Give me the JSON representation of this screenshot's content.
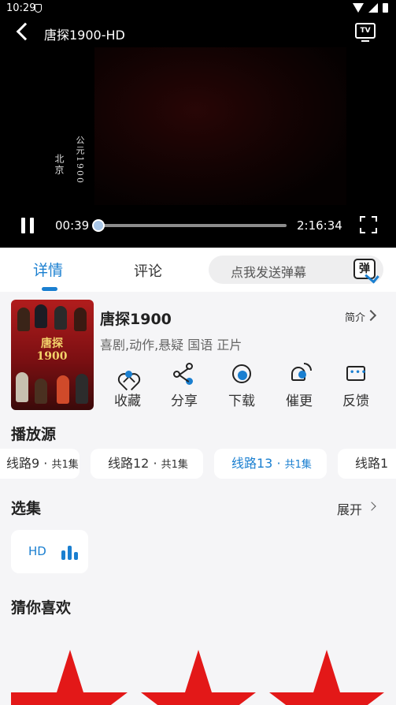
{
  "status_bar": {
    "time": "10:29"
  },
  "player": {
    "title": "唐探1900-HD",
    "overlay_text": [
      "公元1900",
      "北京"
    ],
    "current_time": "00:39",
    "total_time": "2:16:34",
    "progress": 0.005,
    "tv_icon_label": "TV"
  },
  "tabs": {
    "details": "详情",
    "comments": "评论"
  },
  "danmaku": {
    "placeholder": "点我发送弹幕",
    "icon_text": "弹"
  },
  "movie": {
    "title": "唐探1900",
    "tags": "喜剧,动作,悬疑 国语 正片",
    "intro_label": "简介",
    "poster_title": "唐探1900"
  },
  "actions": [
    {
      "label": "收藏",
      "icon": "favorite-icon"
    },
    {
      "label": "分享",
      "icon": "share-icon"
    },
    {
      "label": "下载",
      "icon": "download-icon"
    },
    {
      "label": "催更",
      "icon": "urge-update-icon"
    },
    {
      "label": "反馈",
      "icon": "feedback-icon"
    }
  ],
  "sources": {
    "title": "播放源",
    "items": [
      {
        "name": "线路9",
        "count": "共1集",
        "active": false
      },
      {
        "name": "线路12",
        "count": "共1集",
        "active": false
      },
      {
        "name": "线路13",
        "count": "共1集",
        "active": true
      },
      {
        "name": "线路1",
        "count": "",
        "active": false
      }
    ]
  },
  "episodes": {
    "title": "选集",
    "expand_label": "展开",
    "items": [
      {
        "label": "HD"
      }
    ]
  },
  "recommend": {
    "title": "猜你喜欢"
  },
  "colors": {
    "accent": "#1a7fd0",
    "star": "#e31818",
    "background": "#f5f5f7"
  }
}
